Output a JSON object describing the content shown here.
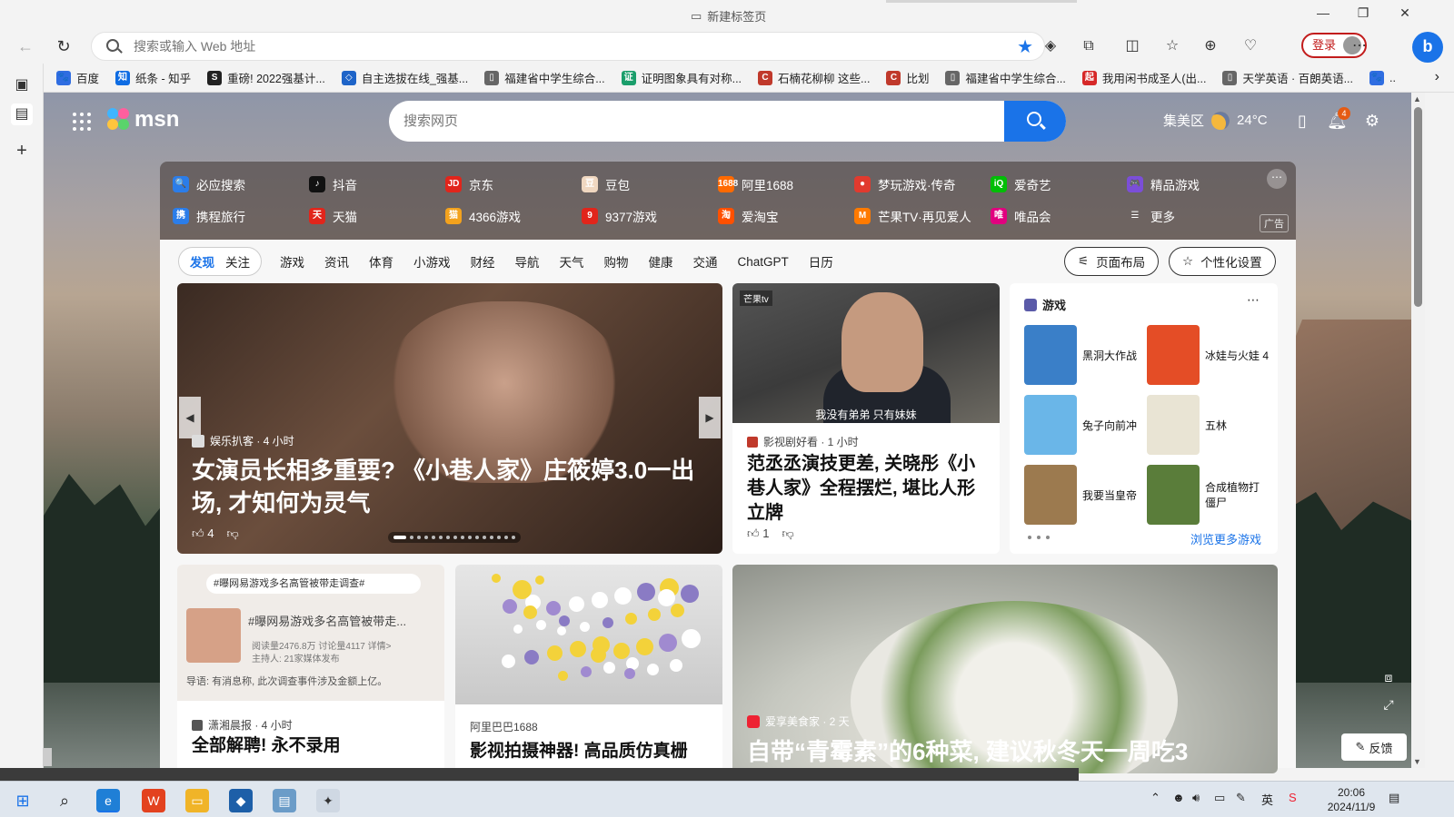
{
  "browser": {
    "window_title": "新建标签页",
    "address_placeholder": "搜索或输入 Web 地址",
    "login_label": "登录"
  },
  "favorites": [
    {
      "label": "百度",
      "color": "#2f6de1",
      "glyph": "🐾"
    },
    {
      "label": "纸条 - 知乎",
      "color": "#0e6ce3",
      "glyph": "知"
    },
    {
      "label": "重磅! 2022强基计...",
      "color": "#222",
      "glyph": "S"
    },
    {
      "label": "自主选拔在线_强基...",
      "color": "#1e64c8",
      "glyph": "◇"
    },
    {
      "label": "福建省中学生综合...",
      "color": "#666",
      "glyph": "▯"
    },
    {
      "label": "证明图象具有对称...",
      "color": "#1a9e6b",
      "glyph": "证"
    },
    {
      "label": "石楠花柳柳 这些...",
      "color": "#c0392b",
      "glyph": "C"
    },
    {
      "label": "比划",
      "color": "#c0392b",
      "glyph": "C"
    },
    {
      "label": "福建省中学生综合...",
      "color": "#666",
      "glyph": "▯"
    },
    {
      "label": "我用闲书成圣人(出...",
      "color": "#d62828",
      "glyph": "起"
    },
    {
      "label": "天学英语 · 百朗英语...",
      "color": "#666",
      "glyph": "▯"
    },
    {
      "label": "..",
      "color": "#2f6de1",
      "glyph": "🐾"
    }
  ],
  "msn": {
    "logo_text": "msn",
    "search_placeholder": "搜索网页",
    "location": "集美区",
    "temperature": "24°C",
    "notification_count": "4"
  },
  "quick_links": [
    {
      "label": "必应搜索",
      "color": "#2b7de9",
      "glyph": "🔍"
    },
    {
      "label": "抖音",
      "color": "#111",
      "glyph": "♪"
    },
    {
      "label": "京东",
      "color": "#e1251b",
      "glyph": "JD"
    },
    {
      "label": "豆包",
      "color": "#f0d7c0",
      "glyph": "豆"
    },
    {
      "label": "阿里1688",
      "color": "#ff6a00",
      "glyph": "1688"
    },
    {
      "label": "梦玩游戏·传奇",
      "color": "#e13a2e",
      "glyph": "●"
    },
    {
      "label": "爱奇艺",
      "color": "#00be06",
      "glyph": "iQ"
    },
    {
      "label": "精品游戏",
      "color": "#7b4ed8",
      "glyph": "🎮"
    },
    {
      "label": "携程旅行",
      "color": "#2b7de9",
      "glyph": "携"
    },
    {
      "label": "天猫",
      "color": "#e1251b",
      "glyph": "天"
    },
    {
      "label": "4366游戏",
      "color": "#f3a21d",
      "glyph": "猫"
    },
    {
      "label": "9377游戏",
      "color": "#e1251b",
      "glyph": "9"
    },
    {
      "label": "爱淘宝",
      "color": "#ff5000",
      "glyph": "淘"
    },
    {
      "label": "芒果TV·再见爱人",
      "color": "#ff7a00",
      "glyph": "M"
    },
    {
      "label": "唯品会",
      "color": "#e1007f",
      "glyph": "唯"
    },
    {
      "label": "更多",
      "color": "transparent",
      "glyph": "☰"
    }
  ],
  "ad_label": "广告",
  "feed": {
    "seg_tabs": [
      "发现",
      "关注"
    ],
    "tabs": [
      "游戏",
      "资讯",
      "体育",
      "小游戏",
      "财经",
      "导航",
      "天气",
      "购物",
      "健康",
      "交通",
      "ChatGPT",
      "日历"
    ],
    "layout_button": "页面布局",
    "personalize_button": "个性化设置"
  },
  "hero": {
    "source": "娱乐扒客 · 4 小时",
    "title": "女演员长相多重要? 《小巷人家》庄筱婷3.0一出场, 才知何为灵气",
    "likes": "4"
  },
  "card2": {
    "image_logo": "芒果tv",
    "subtitle": "我没有弟弟 只有妹妹",
    "source": "影视剧好看 · 1 小时",
    "title": "范丞丞演技更差, 关晓彤《小巷人家》全程摆烂, 堪比人形立牌",
    "likes": "1"
  },
  "games": {
    "heading": "游戏",
    "more_label": "浏览更多游戏",
    "items": [
      {
        "label": "黑洞大作战",
        "color": "#3a7fc8"
      },
      {
        "label": "冰娃与火娃 4",
        "color": "#e44d26"
      },
      {
        "label": "兔子向前冲",
        "color": "#6ab6e8"
      },
      {
        "label": "五林",
        "color": "#e9e4d4"
      },
      {
        "label": "我要当皇帝",
        "color": "#9c7a4f"
      },
      {
        "label": "合成植物打僵尸",
        "color": "#5a7d3a"
      }
    ]
  },
  "card4": {
    "search_tag": "#曝网易游戏多名高管被带走调查#",
    "image_title": "#曝网易游戏多名高管被带走...",
    "image_meta": "阅读量2476.8万 讨论量4117 详情>",
    "image_meta2": "主持人: 21家媒体发布",
    "image_caption": "导语: 有消息称, 此次调查事件涉及金额上亿。",
    "source": "潇湘晨报 · 4 小时",
    "title": "全部解聘! 永不录用"
  },
  "card5": {
    "source": "阿里巴巴1688",
    "title": "影视拍摄神器! 高品质仿真栅"
  },
  "card6": {
    "source": "爱享美食家 · 2 天",
    "title": "自带“青霉素”的6种菜, 建议秋冬天一周吃3"
  },
  "feedback_label": "反馈",
  "taskbar": {
    "time": "20:06",
    "date": "2024/11/9"
  }
}
